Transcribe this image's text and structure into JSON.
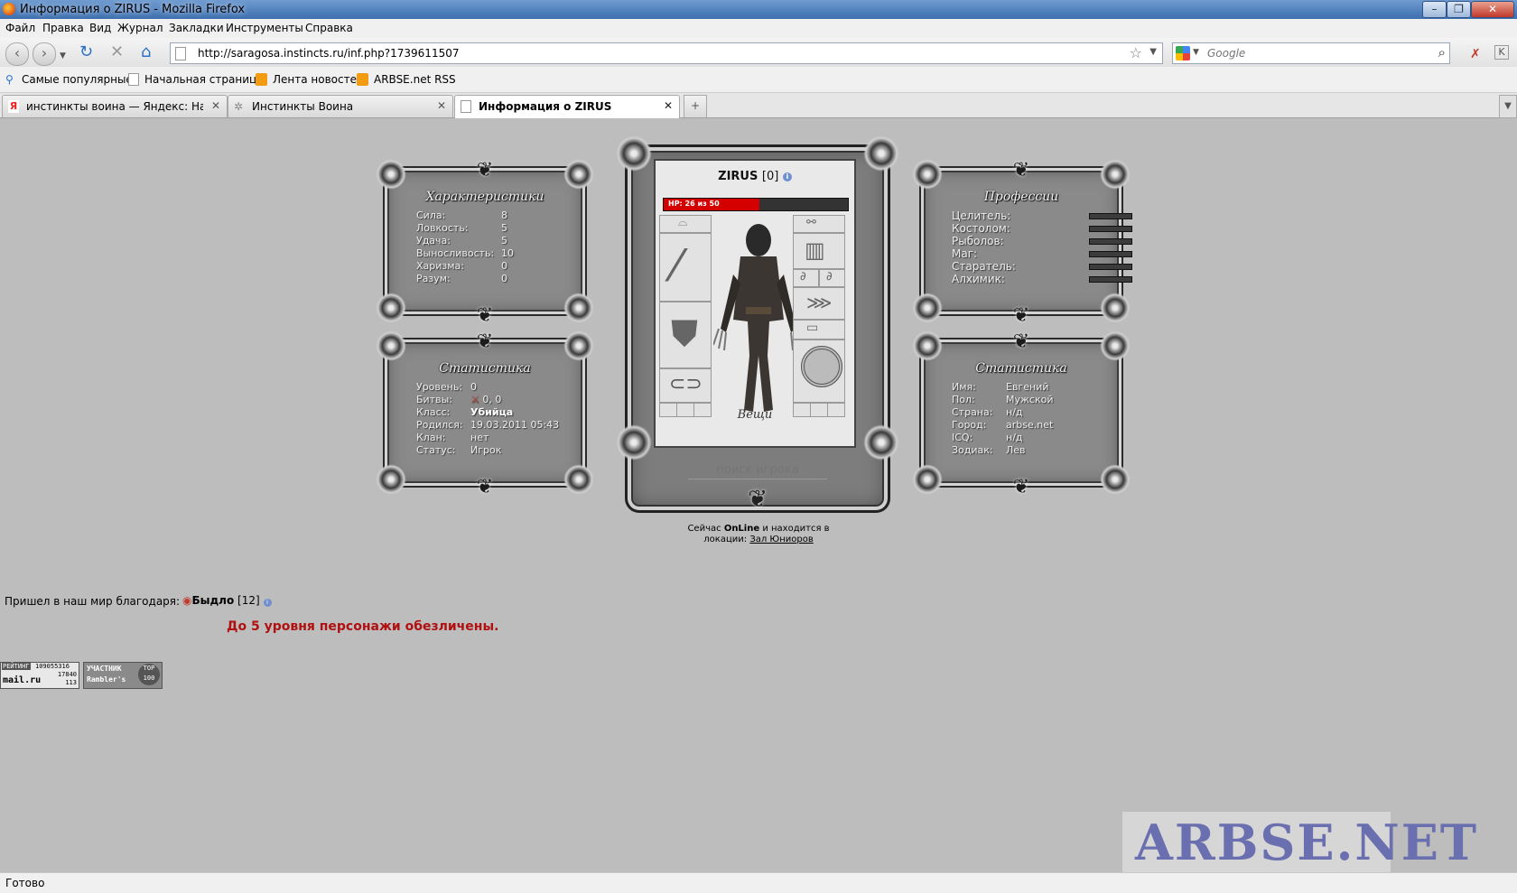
{
  "window": {
    "title": "Информация о ZIRUS - Mozilla Firefox"
  },
  "menu": [
    "Файл",
    "Правка",
    "Вид",
    "Журнал",
    "Закладки",
    "Инструменты",
    "Справка"
  ],
  "url": "http://saragosa.instincts.ru/inf.php?1739611507",
  "search": {
    "placeholder": "Google"
  },
  "bookmarks": [
    "Самые популярные",
    "Начальная страница",
    "Лента новостей",
    "ARBSE.net RSS"
  ],
  "tabs": [
    {
      "label": "инстинкты воина — Яндекс: Наш..."
    },
    {
      "label": "Инстинкты Воина"
    },
    {
      "label": "Информация о ZIRUS"
    }
  ],
  "characteristics": {
    "title": "Характеристики",
    "rows": [
      {
        "label": "Сила:",
        "value": "8"
      },
      {
        "label": "Ловкость:",
        "value": "5"
      },
      {
        "label": "Удача:",
        "value": "5"
      },
      {
        "label": "Выносливость:",
        "value": "10"
      },
      {
        "label": "Харизма:",
        "value": "0"
      },
      {
        "label": "Разум:",
        "value": "0"
      }
    ]
  },
  "stats_left": {
    "title": "Статистика",
    "rows": [
      {
        "label": "Уровень:",
        "value": "0"
      },
      {
        "label": "Битвы:",
        "value": "0, 0"
      },
      {
        "label": "Класс:",
        "value": "Убийца"
      },
      {
        "label": "Родился:",
        "value": "19.03.2011 05:43"
      },
      {
        "label": "Клан:",
        "value": "нет"
      },
      {
        "label": "Статус:",
        "value": "Игрок"
      }
    ]
  },
  "character": {
    "name": "ZIRUS",
    "level": "[0]",
    "hp_text": "HP: 26 из 50",
    "hp_fraction": 0.52,
    "items_label": "Вещи",
    "search_placeholder": "поиск игрока"
  },
  "professions": {
    "title": "Профессии",
    "rows": [
      {
        "label": "Целитель:"
      },
      {
        "label": "Костолом:"
      },
      {
        "label": "Рыболов:"
      },
      {
        "label": "Маг:"
      },
      {
        "label": "Старатель:"
      },
      {
        "label": "Алхимик:"
      }
    ]
  },
  "stats_right": {
    "title": "Статистика",
    "rows": [
      {
        "label": "Имя:",
        "value": "Евгений"
      },
      {
        "label": "Пол:",
        "value": "Мужской"
      },
      {
        "label": "Страна:",
        "value": "н/д"
      },
      {
        "label": "Город:",
        "value": "arbse.net"
      },
      {
        "label": "ICQ:",
        "value": "н/д"
      },
      {
        "label": "Зодиак:",
        "value": "Лев"
      }
    ]
  },
  "online": {
    "prefix": "Сейчас",
    "status": "OnLine",
    "middle": "и находится в",
    "line2_prefix": "локации:",
    "location": "Зал Юниоров"
  },
  "referral": {
    "label": "Пришел в наш мир благодаря:",
    "name": "Быдло",
    "level": "[12]"
  },
  "warning": "До 5 уровня персонажи обезличены.",
  "counters": {
    "mail": {
      "label": "РЕЙТИНГ",
      "line1": "109055316",
      "line2": "17840",
      "line3": "113",
      "brand": "mail.ru"
    },
    "rambler": {
      "line1": "УЧАСТНИК",
      "line2": "Rambler's",
      "badge": "TOP 100"
    }
  },
  "watermark": "ARBSE.NET",
  "status_bar": "Готово",
  "colors": {
    "hp": "#d40000",
    "warning": "#b01010",
    "page_bg": "#bdbdbd"
  }
}
